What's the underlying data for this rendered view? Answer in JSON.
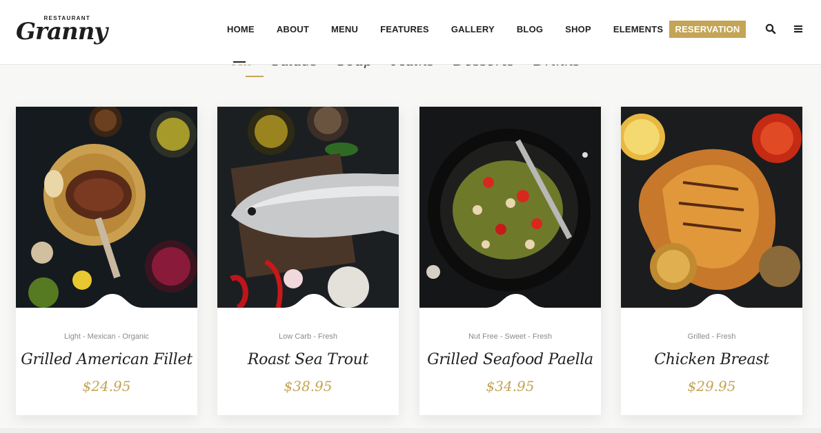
{
  "brand": {
    "small": "RESTAURANT",
    "name": "Granny"
  },
  "nav": {
    "items": [
      "HOME",
      "ABOUT",
      "MENU",
      "FEATURES",
      "GALLERY",
      "BLOG",
      "SHOP",
      "ELEMENTS"
    ],
    "reservation": "RESERVATION"
  },
  "colors": {
    "accent": "#c4a455",
    "text": "#222222",
    "tags": "#8a8a8a",
    "background": "#f7f7f5"
  },
  "icons": {
    "search": "search-icon",
    "menu": "hamburger-menu-icon"
  },
  "filters": {
    "items": [
      "All",
      "Salads",
      "Soup",
      "Mains",
      "Desserts",
      "Drinks"
    ],
    "active": "All"
  },
  "cards": [
    {
      "tags": "Light - Mexican - Organic",
      "title": "Grilled American Fillet",
      "price": "$24.95"
    },
    {
      "tags": "Low Carb - Fresh",
      "title": "Roast Sea Trout",
      "price": "$38.95"
    },
    {
      "tags": "Nut Free - Sweet - Fresh",
      "title": "Grilled Seafood Paella",
      "price": "$34.95"
    },
    {
      "tags": "Grilled - Fresh",
      "title": "Chicken Breast",
      "price": "$29.95"
    }
  ]
}
